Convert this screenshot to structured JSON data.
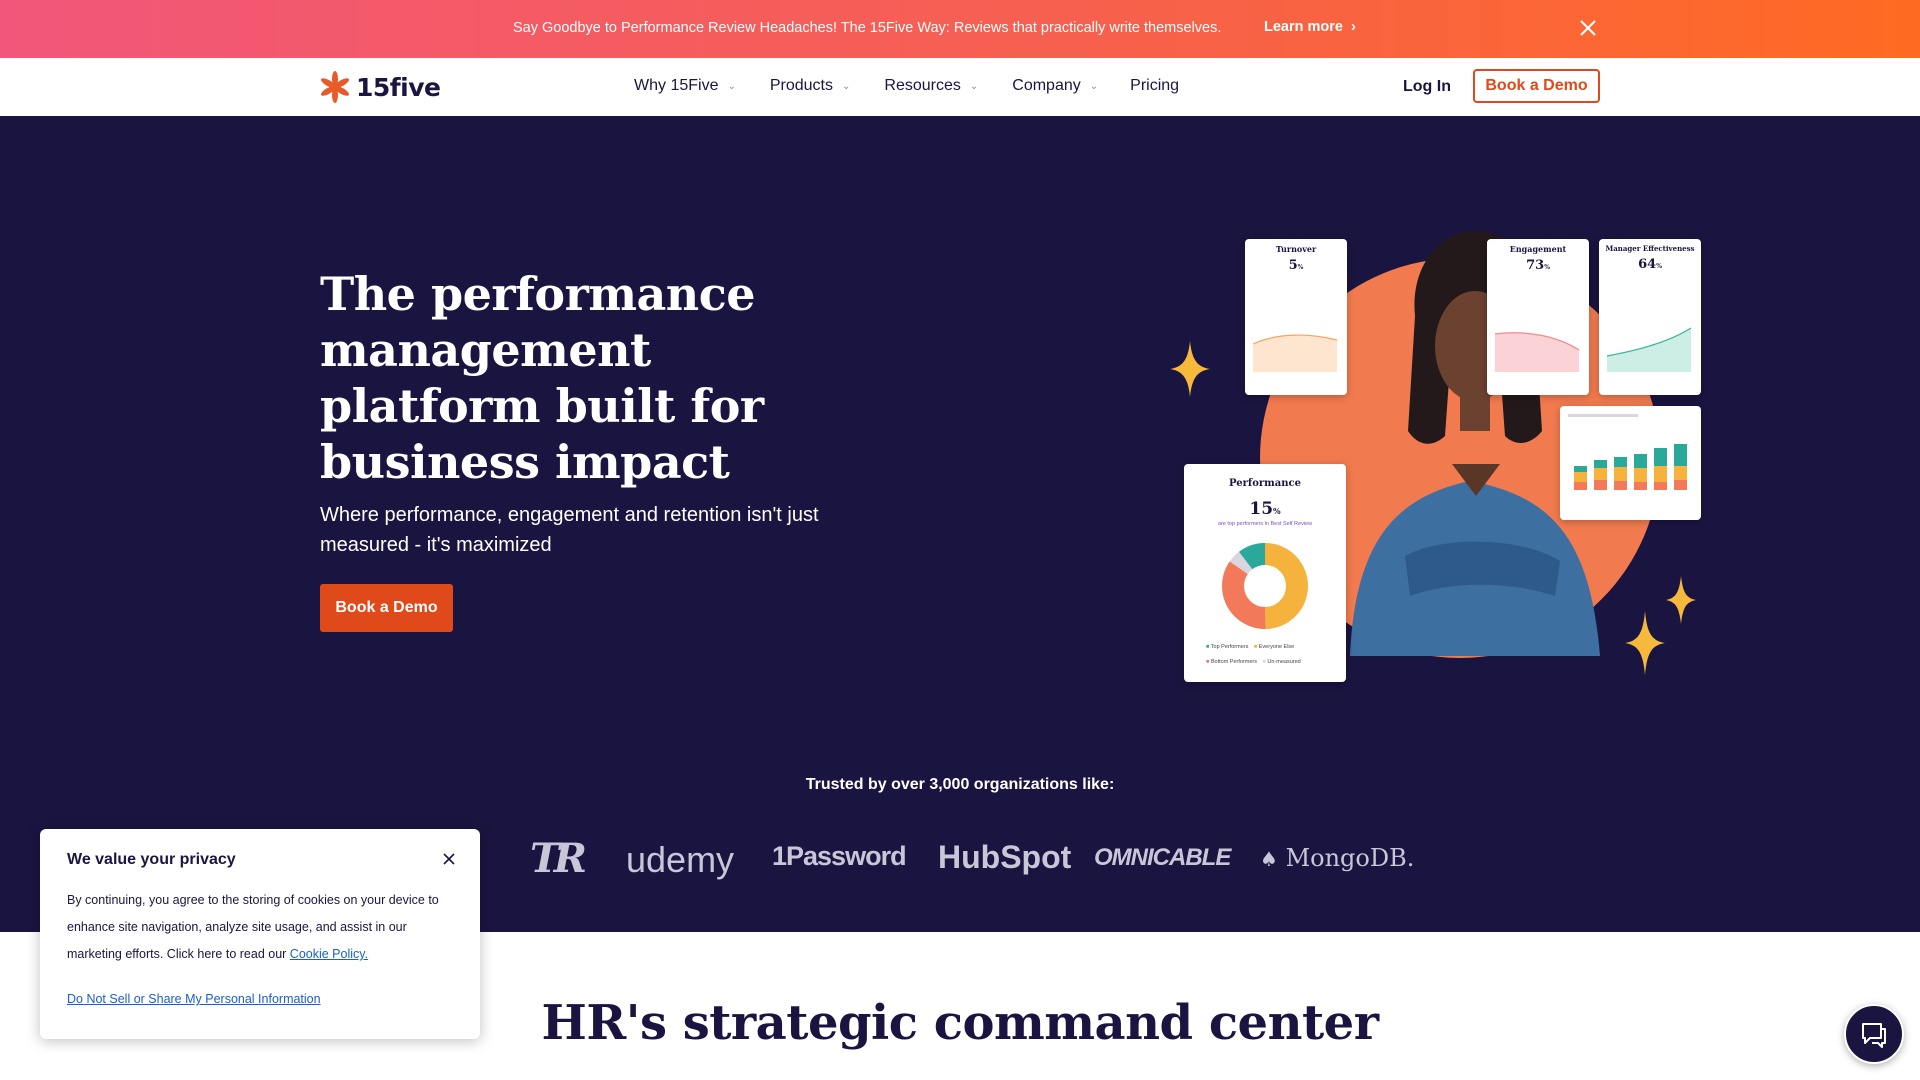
{
  "banner": {
    "text": "Say Goodbye to Performance Review Headaches! The 15Five Way: Reviews that practically write themselves.",
    "link_label": "Learn more",
    "link_icon": "chevron-right-icon",
    "close_icon": "close-icon"
  },
  "nav": {
    "logo_text": "15five",
    "menu": [
      {
        "label": "Why 15Five",
        "has_dropdown": true
      },
      {
        "label": "Products",
        "has_dropdown": true
      },
      {
        "label": "Resources",
        "has_dropdown": true
      },
      {
        "label": "Company",
        "has_dropdown": true
      },
      {
        "label": "Pricing",
        "has_dropdown": false
      }
    ],
    "login_label": "Log In",
    "demo_label": "Book a Demo"
  },
  "hero": {
    "title": "The performance management platform built for business impact",
    "subtitle": "Where performance, engagement and retention isn't just measured - it's maximized",
    "cta_label": "Book a Demo",
    "cards": {
      "turnover": {
        "title": "Turnover",
        "value": "5",
        "unit": "%"
      },
      "engagement": {
        "title": "Engagement",
        "value": "73",
        "unit": "%"
      },
      "manager": {
        "title": "Manager Effectiveness",
        "value": "64",
        "unit": "%"
      },
      "performance": {
        "title": "Performance",
        "value": "15",
        "unit": "%",
        "caption": "are top performers in Best Self Review",
        "legend": [
          "Top Performers",
          "Everyone Else",
          "Bottom Performers",
          "Un-measured"
        ]
      }
    }
  },
  "trusted": {
    "text": "Trusted by over 3,000 organizations like:",
    "logos": [
      "TR",
      "udemy",
      "1Password",
      "HubSpot",
      "OMNICABLE",
      "MongoDB."
    ]
  },
  "section": {
    "title": "HR's strategic command center"
  },
  "cookie": {
    "title": "We value your privacy",
    "body": "By continuing, you agree to the storing of cookies on your device to enhance site navigation, analyze site usage, and assist in our marketing efforts. Click here to read our",
    "policy_link": "Cookie Policy.",
    "dns_link": "Do Not Sell or Share My Personal Information"
  },
  "colors": {
    "brand_orange": "#e0491a",
    "hero_bg": "#1a1440",
    "banner_start": "#f2567a",
    "banner_end": "#ff6a22"
  }
}
